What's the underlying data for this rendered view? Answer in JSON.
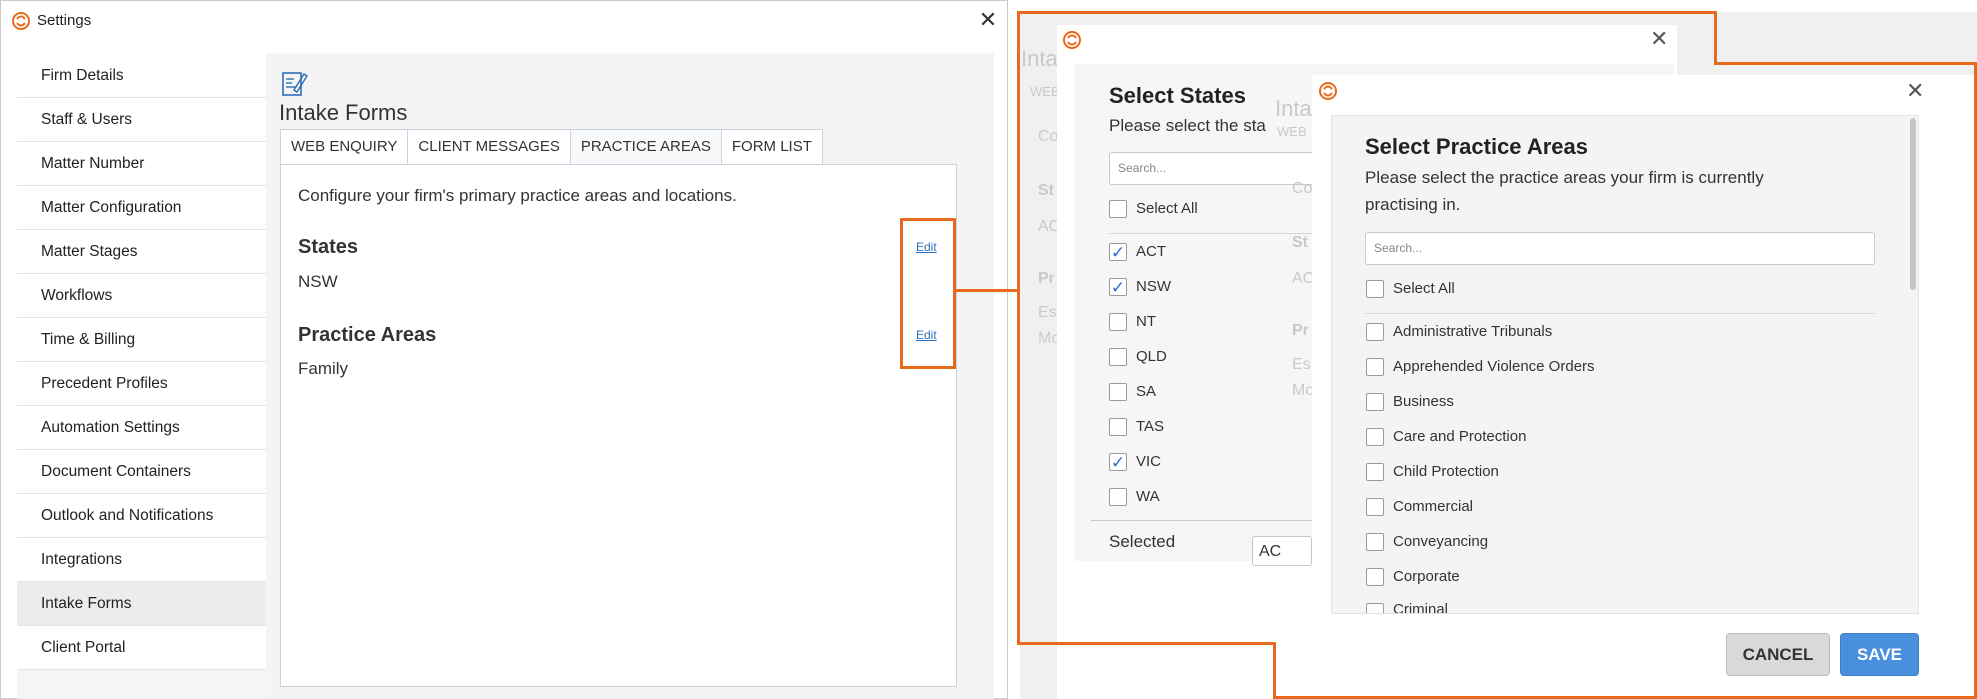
{
  "settings_window": {
    "title": "Settings",
    "close_glyph": "✕",
    "sidebar": [
      {
        "label": "Firm Details"
      },
      {
        "label": "Staff & Users"
      },
      {
        "label": "Matter Number"
      },
      {
        "label": "Matter Configuration"
      },
      {
        "label": "Matter Stages"
      },
      {
        "label": "Workflows"
      },
      {
        "label": "Time & Billing"
      },
      {
        "label": "Precedent Profiles"
      },
      {
        "label": "Automation Settings"
      },
      {
        "label": "Document Containers"
      },
      {
        "label": "Outlook and Notifications"
      },
      {
        "label": "Integrations"
      },
      {
        "label": "Intake Forms",
        "active": true
      },
      {
        "label": "Client Portal"
      }
    ],
    "page_title": "Intake Forms",
    "page_icon": "form-edit-icon",
    "tabs": [
      {
        "label": "WEB ENQUIRY"
      },
      {
        "label": "CLIENT MESSAGES"
      },
      {
        "label": "PRACTICE AREAS",
        "active": true
      },
      {
        "label": "FORM LIST"
      }
    ],
    "panel": {
      "intro": "Configure your firm's primary practice areas and locations.",
      "states_title": "States",
      "states_value": "NSW",
      "practice_title": "Practice Areas",
      "practice_value": "Family",
      "edit_label": "Edit"
    }
  },
  "background_fragments": {
    "t1": "Inta",
    "t2": "WEB",
    "t3": "Co",
    "t4": "St",
    "t5": "AC",
    "t6": "Pr",
    "t7": "Es",
    "t8": "Mo",
    "t9": "Inta",
    "t10": "WEB",
    "t11": "Co",
    "t12": "St",
    "t13": "AC",
    "t14": "Pr",
    "t15": "Es",
    "t16": "Mo"
  },
  "states_dialog": {
    "title": "Select States",
    "subtitle": "Please select the sta",
    "search_placeholder": "Search...",
    "select_all": "Select All",
    "items": [
      {
        "label": "ACT",
        "checked": true
      },
      {
        "label": "NSW",
        "checked": true
      },
      {
        "label": "NT",
        "checked": false
      },
      {
        "label": "QLD",
        "checked": false
      },
      {
        "label": "SA",
        "checked": false
      },
      {
        "label": "TAS",
        "checked": false
      },
      {
        "label": "VIC",
        "checked": true
      },
      {
        "label": "WA",
        "checked": false
      }
    ],
    "selected_label": "Selected",
    "selected_chip": "AC",
    "close_glyph": "✕"
  },
  "practice_dialog": {
    "title": "Select Practice Areas",
    "subtitle_line1": "Please select the practice areas your firm is currently",
    "subtitle_line2": "practising in.",
    "search_placeholder": "Search...",
    "select_all": "Select All",
    "items": [
      {
        "label": "Administrative Tribunals",
        "checked": false
      },
      {
        "label": "Apprehended Violence Orders",
        "checked": false
      },
      {
        "label": "Business",
        "checked": false
      },
      {
        "label": "Care and Protection",
        "checked": false
      },
      {
        "label": "Child Protection",
        "checked": false
      },
      {
        "label": "Commercial",
        "checked": false
      },
      {
        "label": "Conveyancing",
        "checked": false
      },
      {
        "label": "Corporate",
        "checked": false
      },
      {
        "label": "Criminal",
        "checked": false
      }
    ],
    "cancel_label": "CANCEL",
    "save_label": "SAVE",
    "close_glyph": "✕"
  },
  "colors": {
    "accent_orange": "#e86a1c",
    "link_blue": "#2a70c2",
    "save_blue": "#4a8fdd",
    "check_blue": "#2a72c9"
  }
}
